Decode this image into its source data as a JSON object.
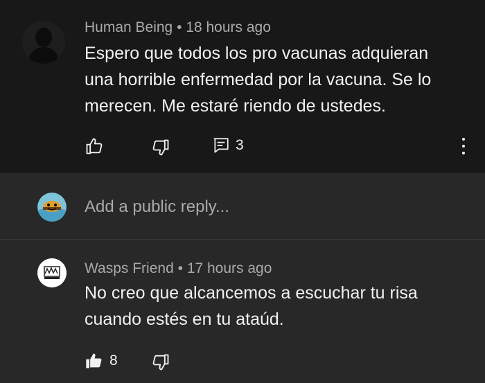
{
  "comment": {
    "author": "Human Being",
    "separator": "•",
    "time": "18 hours ago",
    "text_lines": [
      "Espero que todos los pro vacunas adquieran",
      "una horrible enfermedad por la vacuna. Se lo",
      "merecen. Me estaré riendo de ustedes."
    ],
    "reply_count": "3"
  },
  "reply_box": {
    "placeholder": "Add a public reply..."
  },
  "reply": {
    "author": "Wasps Friend",
    "separator": "•",
    "time": "17 hours ago",
    "text_lines": [
      "No creo que alcancemos a escuchar tu risa",
      "cuando estés en tu ataúd."
    ],
    "like_count": "8",
    "liked": true
  },
  "colors": {
    "top_background": "#181818",
    "page_background": "#282828",
    "primary_text": "#f1f1f1",
    "secondary_text": "#aaaaaa"
  },
  "icons": [
    "default-avatar-icon",
    "like-icon",
    "dislike-icon",
    "replies-icon",
    "more-vert-icon",
    "user-avatar-icon",
    "like-filled-icon"
  ]
}
